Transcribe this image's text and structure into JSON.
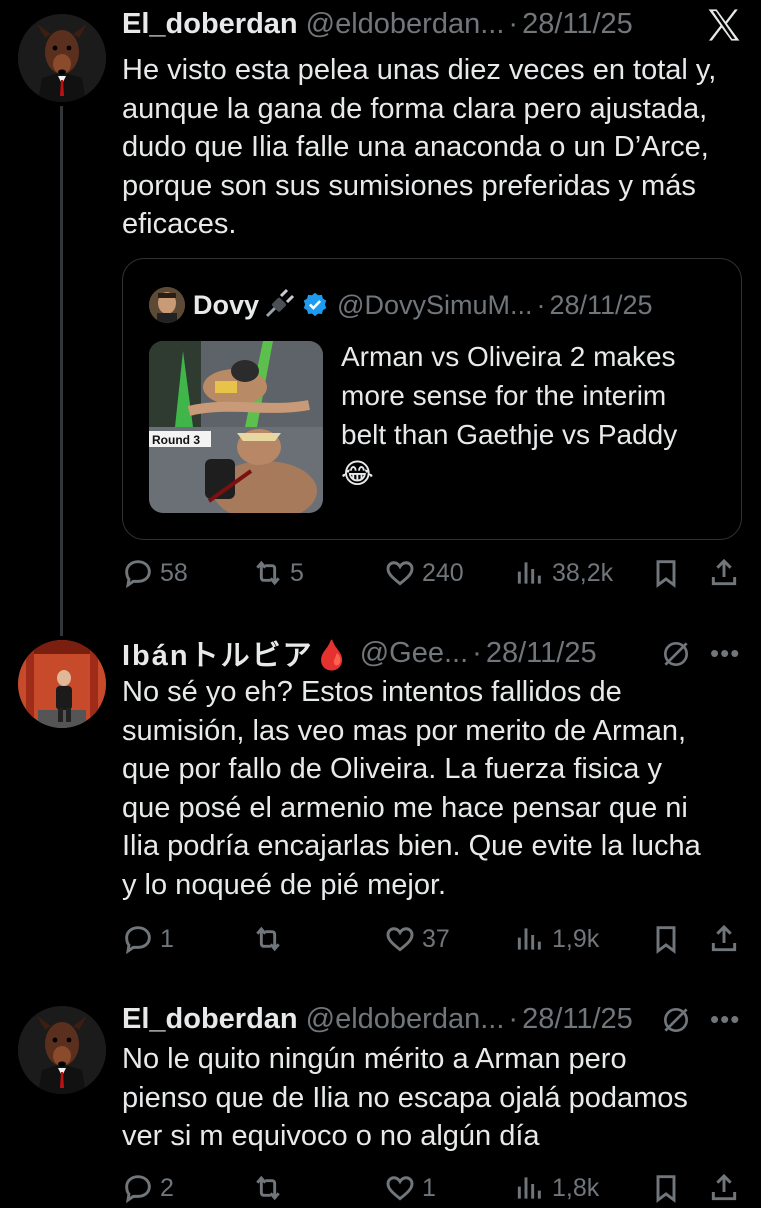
{
  "thread": [
    {
      "name": "El_doberdan",
      "handle": "@eldoberdan...",
      "sep": "·",
      "date": "28/11/25",
      "text": "He visto esta pelea unas diez veces en total y,\naunque la gana de forma clara pero ajustada,\ndudo que Ilia falle una anaconda o un D’Arce,\nporque son sus sumisiones preferidas y más\neficaces.",
      "quote": {
        "name": "Dovy",
        "handle": "@DovySimuM...",
        "sep": "·",
        "date": "28/11/25",
        "text": "Arman vs Oliveira 2 makes\nmore sense for the interim\nbelt than Gaethje vs Paddy\n😂",
        "image_label": "Round 3"
      },
      "replies": "58",
      "reposts": "5",
      "likes": "240",
      "views": "38,2k"
    },
    {
      "name": "Ibánトルビア🩸",
      "handle": "@Gee...",
      "sep": "·",
      "date": "28/11/25",
      "text": "No sé yo eh? Estos intentos fallidos de\nsumisión, las veo mas por merito de Arman,\nque por fallo de Oliveira. La fuerza fisica y\nque posé el armenio me hace pensar que ni\nIlia podría encajarlas bien. Que evite la lucha\ny lo noqueé de pié mejor.",
      "replies": "1",
      "reposts": "",
      "likes": "37",
      "views": "1,9k"
    },
    {
      "name": "El_doberdan",
      "handle": "@eldoberdan...",
      "sep": "·",
      "date": "28/11/25",
      "text": "No le quito ningún mérito a Arman pero\npienso que de Ilia no escapa ojalá podamos\nver si m equivoco o no algún día",
      "replies": "2",
      "reposts": "",
      "likes": "1",
      "views": "1,8k"
    }
  ],
  "more_label": "•••",
  "colors": {
    "background": "#000000",
    "text": "#e7e9ea",
    "muted": "#71767b",
    "verified": "#1d9bf0",
    "blood": "#d4101c"
  },
  "icons": [
    "x-logo-icon",
    "reply-icon",
    "repost-icon",
    "like-icon",
    "views-icon",
    "bookmark-icon",
    "share-icon",
    "grok-icon",
    "verified-icon"
  ]
}
